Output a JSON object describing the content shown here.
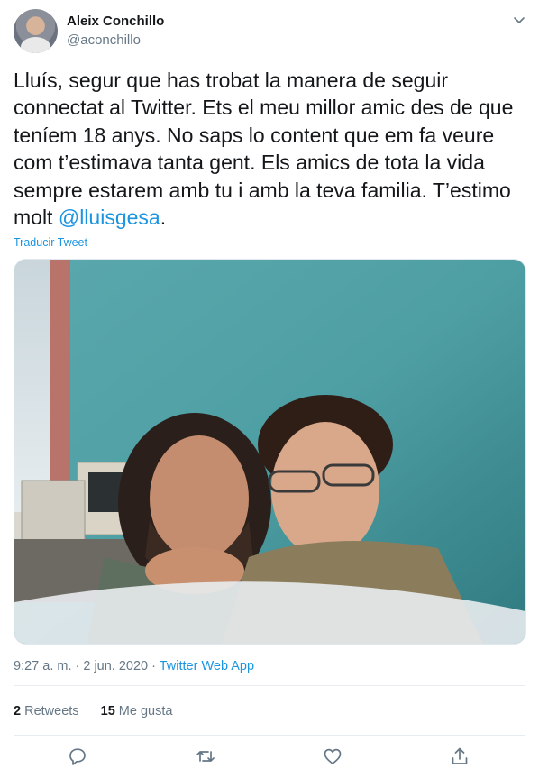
{
  "author": {
    "name": "Aleix Conchillo",
    "handle": "@aconchillo"
  },
  "tweet": {
    "text": "Lluís, segur que has trobat la manera de seguir connectat al Twitter. Ets el meu millor amic des de que teníem 18 anys. No saps lo content que em fa veure com t’estimava tanta gent. Els amics de tota la vida sempre estarem amb tu i amb la teva familia. T’estimo molt ",
    "mention": "@lluisgesa",
    "end": ".",
    "translate_label": "Traducir Tweet"
  },
  "meta": {
    "time_date": "9:27 a. m. · 2 jun. 2020 · ",
    "app": "Twitter Web App"
  },
  "stats": {
    "retweets_count": "2",
    "retweets_label": "Retweets",
    "likes_count": "15",
    "likes_label": "Me gusta"
  },
  "colors": {
    "link": "#1b95e0",
    "secondary_text": "#657786",
    "primary_text": "#14171a"
  },
  "icons": [
    "chevron-down-icon",
    "reply-icon",
    "retweet-icon",
    "like-icon",
    "share-icon"
  ]
}
